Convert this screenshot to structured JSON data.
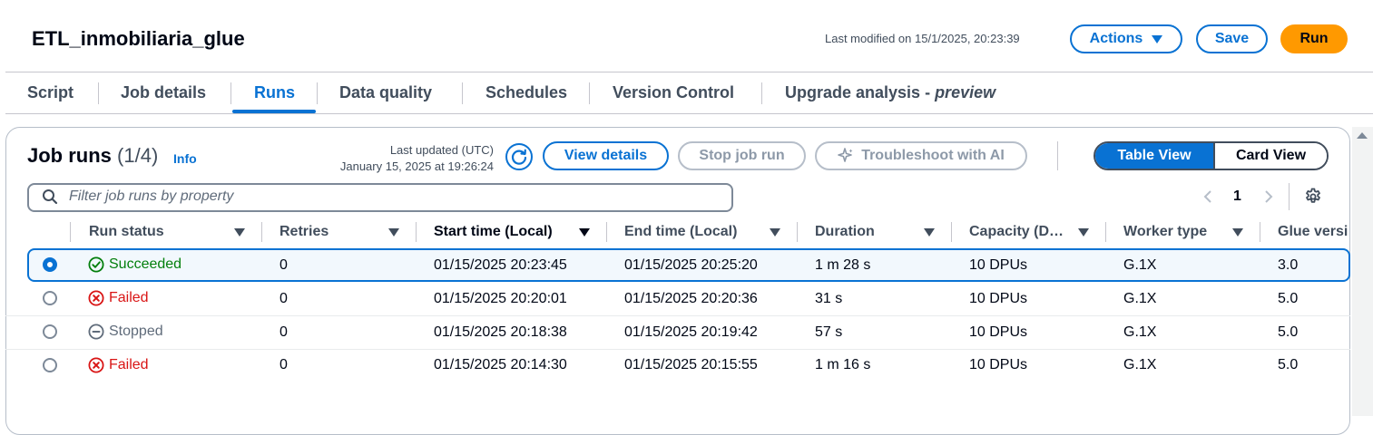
{
  "header": {
    "job_name": "ETL_inmobiliaria_glue",
    "last_modified": "Last modified on 15/1/2025, 20:23:39",
    "actions_label": "Actions",
    "save_label": "Save",
    "run_label": "Run"
  },
  "tabs": [
    {
      "label": "Script"
    },
    {
      "label": "Job details"
    },
    {
      "label": "Runs",
      "active": true
    },
    {
      "label": "Data quality"
    },
    {
      "label": "Schedules"
    },
    {
      "label": "Version Control"
    },
    {
      "label": "Upgrade analysis - ",
      "suffix": "preview"
    }
  ],
  "job_runs": {
    "title": "Job runs",
    "count": "(1/4)",
    "info": "Info",
    "last_updated_label": "Last updated (UTC)",
    "last_updated_value": "January 15, 2025 at 19:26:24",
    "view_details": "View details",
    "stop_job_run": "Stop job run",
    "troubleshoot": "Troubleshoot with AI",
    "table_view": "Table View",
    "card_view": "Card View",
    "filter_placeholder": "Filter job runs by property",
    "page": "1"
  },
  "columns": [
    "Run status",
    "Retries",
    "Start time (Local)",
    "End time (Local)",
    "Duration",
    "Capacity (D…",
    "Worker type",
    "Glue versi"
  ],
  "rows": [
    {
      "status": "Succeeded",
      "retries": "0",
      "start": "01/15/2025 20:23:45",
      "end": "01/15/2025 20:25:20",
      "duration": "1 m 28 s",
      "capacity": "10 DPUs",
      "worker": "G.1X",
      "glue": "3.0"
    },
    {
      "status": "Failed",
      "retries": "0",
      "start": "01/15/2025 20:20:01",
      "end": "01/15/2025 20:20:36",
      "duration": "31 s",
      "capacity": "10 DPUs",
      "worker": "G.1X",
      "glue": "5.0"
    },
    {
      "status": "Stopped",
      "retries": "0",
      "start": "01/15/2025 20:18:38",
      "end": "01/15/2025 20:19:42",
      "duration": "57 s",
      "capacity": "10 DPUs",
      "worker": "G.1X",
      "glue": "5.0"
    },
    {
      "status": "Failed",
      "retries": "0",
      "start": "01/15/2025 20:14:30",
      "end": "01/15/2025 20:15:55",
      "duration": "1 m 16 s",
      "capacity": "10 DPUs",
      "worker": "G.1X",
      "glue": "5.0"
    }
  ],
  "colors": {
    "accent": "#0972d3",
    "run": "#ff9900",
    "success": "#037f0c",
    "error": "#d91515",
    "stopped": "#5f6b7a"
  }
}
